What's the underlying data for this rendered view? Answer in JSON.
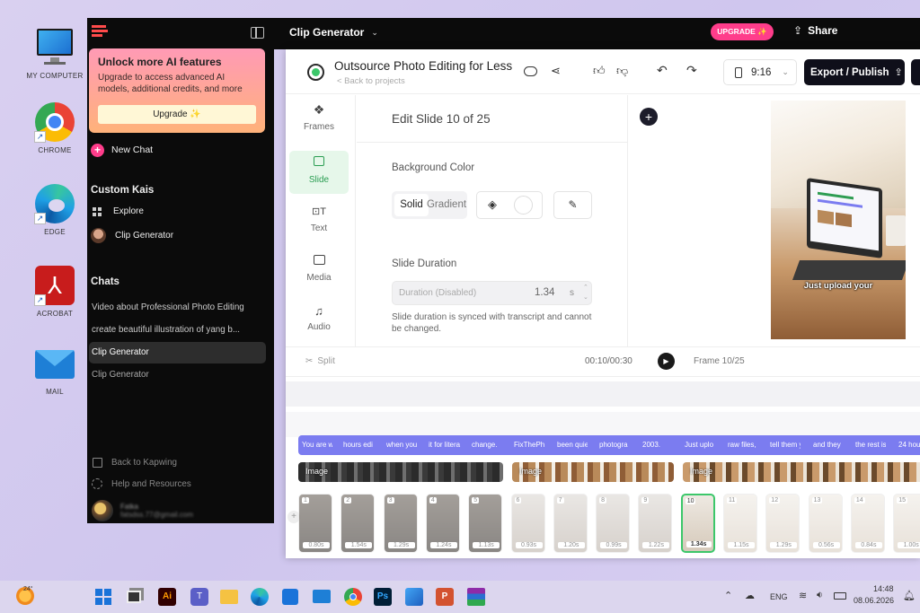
{
  "desktop": {
    "icons": [
      {
        "label": "MY COMPUTER",
        "icon": "monitor-icon"
      },
      {
        "label": "CHROME",
        "icon": "chrome-icon"
      },
      {
        "label": "EDGE",
        "icon": "edge-icon"
      },
      {
        "label": "ACROBAT",
        "icon": "acrobat-icon"
      },
      {
        "label": "MAIL",
        "icon": "mail-icon"
      }
    ]
  },
  "sidebar": {
    "promo": {
      "title": "Unlock more AI features",
      "body": "Upgrade to access advanced AI models, additional credits, and more",
      "button": "Upgrade ✨"
    },
    "new_chat": "New Chat",
    "custom_heading": "Custom Kais",
    "custom_items": [
      "Explore",
      "Clip Generator"
    ],
    "chats_heading": "Chats",
    "chats": [
      "Video about Professional Photo Editing",
      "create beautiful illustration of yang b...",
      "Clip Generator",
      "Clip Generator"
    ],
    "selected_chat_index": 2,
    "footer": [
      "Back to Kapwing",
      "Help and Resources"
    ],
    "user_name": "Fatka",
    "user_email": "fatsdss.77@gmail.com"
  },
  "topbar": {
    "title": "Clip Generator",
    "upgrade": "UPGRADE ✨",
    "share": "Share"
  },
  "editor": {
    "project_title": "Outsource Photo Editing for Less",
    "back_link": "< Back to projects",
    "aspect": "9:16",
    "export": "Export / Publish",
    "tools": [
      "Frames",
      "Slide",
      "Text",
      "Media",
      "Audio"
    ],
    "active_tool_index": 1,
    "panel_title": "Edit Slide 10 of 25",
    "bg_label": "Background Color",
    "bg_tabs": [
      "Solid",
      "Gradient"
    ],
    "duration_label": "Slide Duration",
    "duration_placeholder": "Duration (Disabled)",
    "duration_value": "1.34",
    "duration_unit": "s",
    "duration_note": "Slide duration is synced with transcript and cannot be changed.",
    "preview_caption": "Just upload your",
    "split": "Split",
    "time": "00:10/00:30",
    "frame": "Frame 10/25",
    "captions": [
      "You are w",
      "hours edi",
      "when you",
      "it for litera",
      "change.",
      "FixThePh",
      "been quie",
      "photogra",
      "2003.",
      "Just uplo",
      "raw files,",
      "tell them y",
      "and they",
      "the rest is",
      "24 hou"
    ],
    "image_tracks": [
      "Image",
      "Image",
      "Image"
    ],
    "slides": [
      {
        "n": "1",
        "d": "0.80s"
      },
      {
        "n": "2",
        "d": "1.54s"
      },
      {
        "n": "3",
        "d": "1.29s"
      },
      {
        "n": "4",
        "d": "1.24s"
      },
      {
        "n": "5",
        "d": "1.13s"
      },
      {
        "n": "6",
        "d": "0.93s"
      },
      {
        "n": "7",
        "d": "1.20s"
      },
      {
        "n": "8",
        "d": "0.99s"
      },
      {
        "n": "9",
        "d": "1.22s"
      },
      {
        "n": "10",
        "d": "1.34s"
      },
      {
        "n": "11",
        "d": "1.15s"
      },
      {
        "n": "12",
        "d": "1.29s"
      },
      {
        "n": "13",
        "d": "0.56s"
      },
      {
        "n": "14",
        "d": "0.84s"
      },
      {
        "n": "15",
        "d": "1.00s"
      }
    ],
    "active_slide_index": 9
  },
  "taskbar": {
    "weather": "24°",
    "lang": "ENG",
    "time": "14:48",
    "date": "08.06.2026"
  },
  "colors": {
    "accent_pink": "#ff3d8b",
    "active_green": "#3cc76a",
    "caption_purple": "#7b7cf0"
  }
}
